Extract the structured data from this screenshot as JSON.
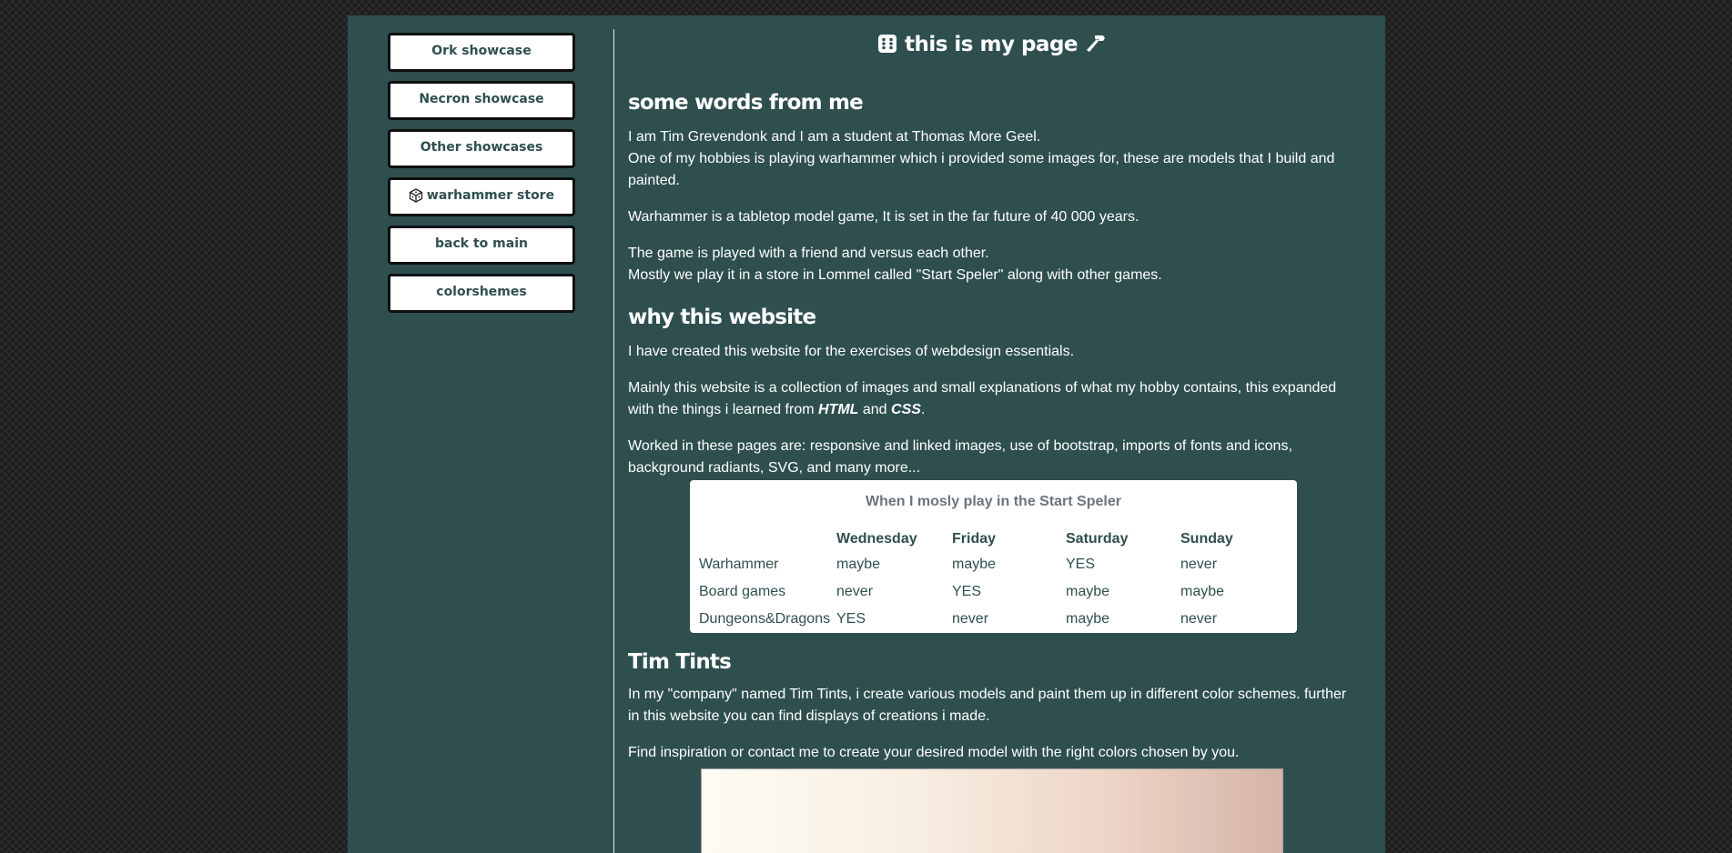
{
  "nav": {
    "items": [
      {
        "label": "Ork showcase",
        "icon": ""
      },
      {
        "label": "Necron showcase",
        "icon": ""
      },
      {
        "label": "Other showcases",
        "icon": ""
      },
      {
        "label": "warhammer store",
        "icon": "dice-icon"
      },
      {
        "label": "back to main",
        "icon": ""
      },
      {
        "label": "colorshemes",
        "icon": ""
      }
    ]
  },
  "header": {
    "title": "this is my page",
    "left_icon": "dice-icon",
    "right_icon": "hammer-icon"
  },
  "sections": {
    "words": {
      "heading": "some words from me",
      "p1_line1": "I am Tim Grevendonk and I am a student at Thomas More Geel.",
      "p1_line2": "One of my hobbies is playing warhammer which i provided some images for, these are models that I build and painted.",
      "p2": "Warhammer is a tabletop model game, It is set in the far future of 40 000 years.",
      "p3_line1": "The game is played with a friend and versus each other.",
      "p3_line2": "Mostly we play it in a store in Lommel called \"Start Speler\" along with other games."
    },
    "why": {
      "heading": "why this website",
      "p1": "I have created this website for the exercises of webdesign essentials.",
      "p2_a": "Mainly this website is a collection of images and small explanations of what my hobby contains, this expanded with the things i learned from ",
      "p2_html": "HTML",
      "p2_and": " and ",
      "p2_css": "CSS",
      "p2_end": ".",
      "p3": "Worked in these pages are: responsive and linked images, use of bootstrap, imports of fonts and icons, background radiants, SVG, and many more..."
    },
    "tints": {
      "heading": "Tim Tints",
      "p1": "In my \"company\" named Tim Tints, i create various models and paint them up in different color schemes. further in this website you can find displays of creations i made.",
      "p2": "Find inspiration or contact me to create your desired model with the right colors chosen by you."
    }
  },
  "schedule": {
    "caption": "When I mosly play in the Start Speler",
    "headers": [
      "",
      "Wednesday",
      "Friday",
      "Saturday",
      "Sunday"
    ],
    "rows": [
      [
        "Warhammer",
        "maybe",
        "maybe",
        "YES",
        "never"
      ],
      [
        "Board games",
        "never",
        "YES",
        "maybe",
        "maybe"
      ],
      [
        "Dungeons&Dragons",
        "YES",
        "never",
        "maybe",
        "never"
      ]
    ]
  },
  "colors": {
    "page_bg": "#2f4f4f",
    "button_bg": "#ffffff",
    "button_text": "#2f4f4f",
    "table_caption": "#6c757d"
  }
}
